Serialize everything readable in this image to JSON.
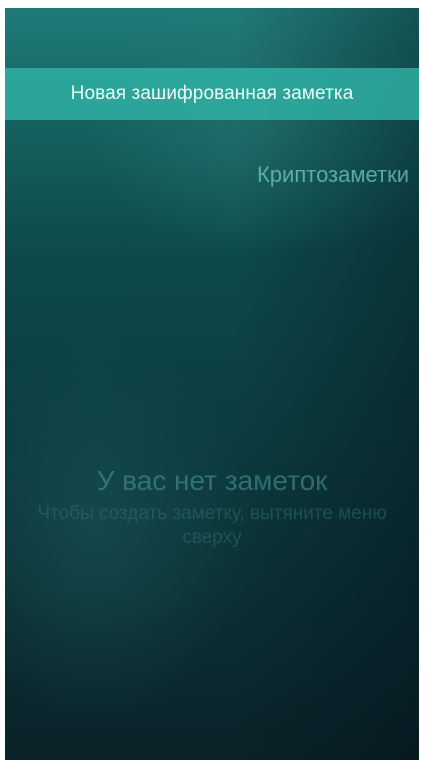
{
  "pulley_menu": {
    "items": [
      {
        "label": "Новая зашифрованная заметка"
      }
    ]
  },
  "header": {
    "title": "Криптозаметки"
  },
  "placeholder": {
    "text": "У вас нет заметок",
    "hint": "Чтобы создать заметку, вытяните меню сверху"
  }
}
